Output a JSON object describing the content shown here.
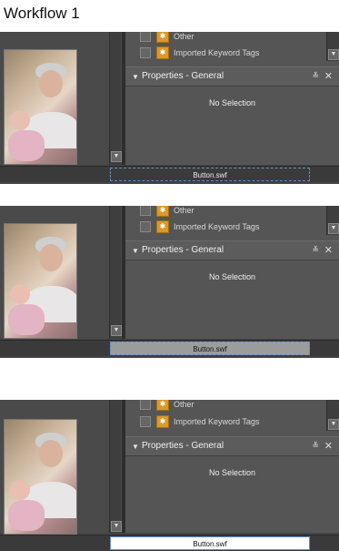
{
  "page": {
    "title": "Workflow 1"
  },
  "frames": [
    {
      "state": "idle"
    },
    {
      "state": "hover"
    },
    {
      "state": "pressed"
    }
  ],
  "keywords": {
    "item_other": "Other",
    "item_imported": "Imported Keyword Tags"
  },
  "properties_panel": {
    "title": "Properties - General",
    "empty_text": "No Selection"
  },
  "button": {
    "label": "Button.swf"
  },
  "colors": {
    "panel_bg": "#555555",
    "header_bg": "#5c5c5c",
    "tag_icon": "#d99a2b",
    "focus_border": "#5d8fc9"
  },
  "icons": [
    "chevron-down-icon",
    "collapse-icon",
    "close-icon",
    "tag-icon",
    "checkbox"
  ]
}
